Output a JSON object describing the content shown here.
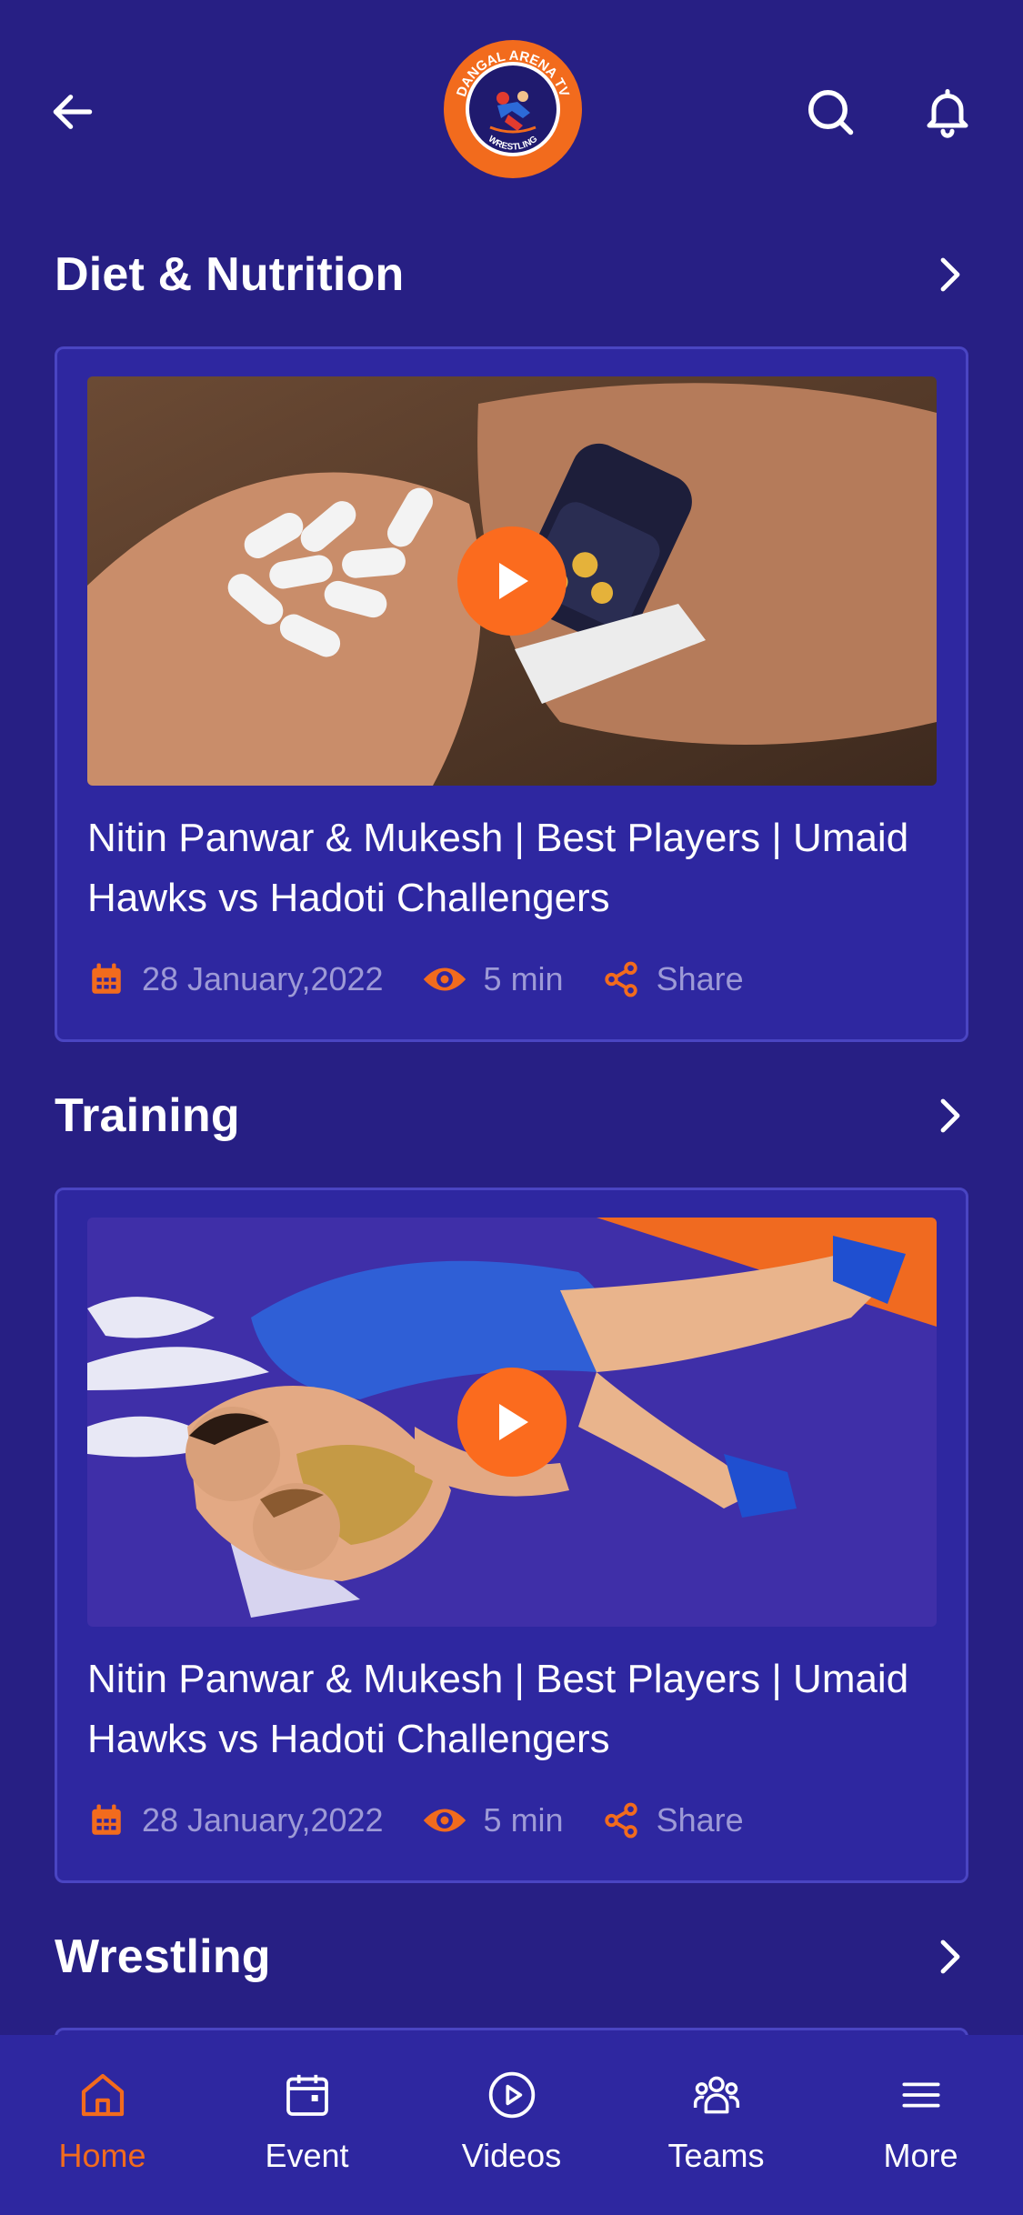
{
  "header": {
    "logo": {
      "line1": "DANGAL ARENA TV",
      "line2": "WRESTLING"
    },
    "icons": {
      "back": "arrow-left-icon",
      "search": "search-icon",
      "notifications": "bell-icon"
    }
  },
  "sections": [
    {
      "title": "Diet & Nutrition",
      "card": {
        "title": "Nitin Panwar & Mukesh | Best Players | Umaid Hawks vs Hadoti Challengers",
        "date": "28 January,2022",
        "duration": "5 min",
        "share": "Share"
      }
    },
    {
      "title": "Training",
      "card": {
        "title": "Nitin Panwar & Mukesh | Best Players | Umaid Hawks vs Hadoti Challengers",
        "date": "28 January,2022",
        "duration": "5 min",
        "share": "Share"
      }
    },
    {
      "title": "Wrestling"
    }
  ],
  "bottom_nav": {
    "active": "Home",
    "items": [
      {
        "label": "Home",
        "icon": "home-icon"
      },
      {
        "label": "Event",
        "icon": "calendar-icon"
      },
      {
        "label": "Videos",
        "icon": "play-circle-icon"
      },
      {
        "label": "Teams",
        "icon": "teams-icon"
      },
      {
        "label": "More",
        "icon": "menu-icon"
      }
    ]
  },
  "colors": {
    "background": "#271f84",
    "card": "#2e27a0",
    "card_border": "#4a45c2",
    "accent": "#f26b1d",
    "muted_text": "#9d9ad6"
  }
}
